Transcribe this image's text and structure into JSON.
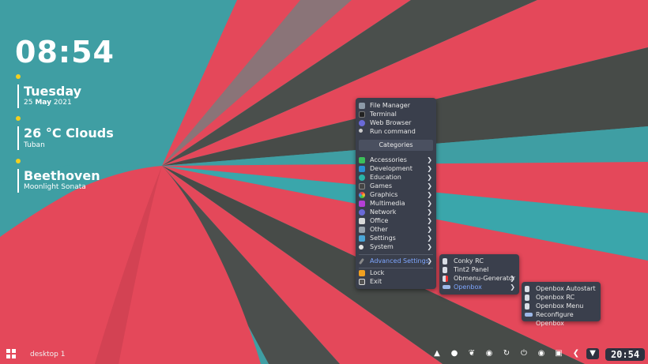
{
  "conky": {
    "time": "08:54",
    "date_day": "Tuesday",
    "date_prefix": "25 ",
    "date_month": "May",
    "date_year": " 2021",
    "weather": "26 °C Clouds",
    "location": "Tuban",
    "artist": "Beethoven",
    "track": "Moonlight Sonata"
  },
  "menu": {
    "top_items": [
      {
        "label": "File Manager",
        "icon": "file-manager-icon"
      },
      {
        "label": "Terminal",
        "icon": "terminal-icon"
      },
      {
        "label": "Web Browser",
        "icon": "web-browser-icon"
      },
      {
        "label": "Run command",
        "icon": "run-command-icon"
      }
    ],
    "categories_header": "Categories",
    "categories": [
      {
        "label": "Accessories",
        "icon": "accessories-icon"
      },
      {
        "label": "Development",
        "icon": "development-icon"
      },
      {
        "label": "Education",
        "icon": "education-icon"
      },
      {
        "label": "Games",
        "icon": "games-icon"
      },
      {
        "label": "Graphics",
        "icon": "graphics-icon"
      },
      {
        "label": "Multimedia",
        "icon": "multimedia-icon"
      },
      {
        "label": "Network",
        "icon": "network-icon"
      },
      {
        "label": "Office",
        "icon": "office-icon"
      },
      {
        "label": "Other",
        "icon": "other-icon"
      },
      {
        "label": "Settings",
        "icon": "settings-icon"
      },
      {
        "label": "System",
        "icon": "system-icon"
      }
    ],
    "advanced": "Advanced Settings",
    "lock": "Lock",
    "exit": "Exit"
  },
  "submenu_advanced": [
    "Conky RC",
    "Tint2 Panel",
    "Obmenu-Generator",
    "Openbox"
  ],
  "submenu_openbox": [
    "Openbox Autostart",
    "Openbox RC",
    "Openbox Menu",
    "Reconfigure Openbox"
  ],
  "panel": {
    "desktop_label": "desktop 1",
    "clock": "20:54"
  },
  "colors": {
    "teal": "#3f9ea3",
    "red": "#e4485a",
    "dark": "#474b48",
    "menu_bg": "#3a3f4c",
    "accent_yellow": "#f3cf1f",
    "selected_text": "#7ea6ff"
  }
}
